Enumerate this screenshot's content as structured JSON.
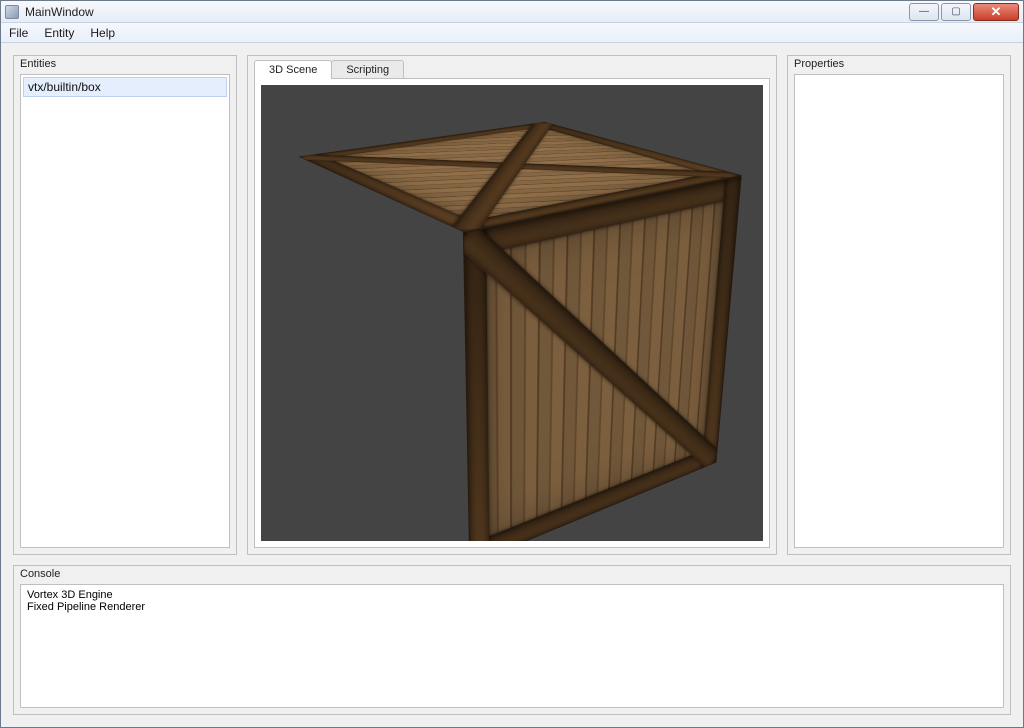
{
  "window": {
    "title": "MainWindow"
  },
  "menubar": {
    "items": [
      "File",
      "Entity",
      "Help"
    ]
  },
  "panels": {
    "entities": {
      "title": "Entities",
      "items": [
        "vtx/builtin/box"
      ]
    },
    "properties": {
      "title": "Properties"
    },
    "console": {
      "title": "Console",
      "lines": [
        "Vortex 3D Engine",
        "Fixed Pipeline Renderer"
      ]
    }
  },
  "tabs": {
    "items": [
      "3D Scene",
      "Scripting"
    ],
    "active_index": 0
  },
  "icons": {
    "minimize": "—",
    "maximize": "▢",
    "close": "✕"
  },
  "colors": {
    "viewport_bg": "#444444",
    "selection_bg": "#e4eefc"
  }
}
